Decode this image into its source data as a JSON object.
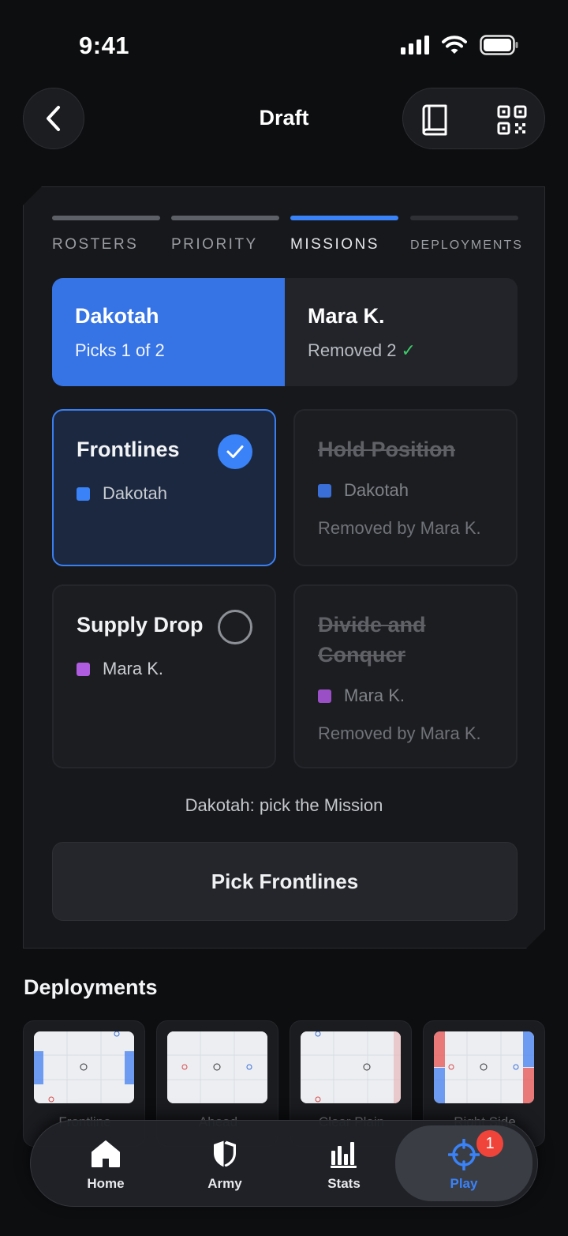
{
  "status": {
    "time": "9:41"
  },
  "header": {
    "title": "Draft",
    "back_icon": "chevron-left-icon",
    "book_icon": "book-icon",
    "qr_icon": "qr-code-icon"
  },
  "steps": [
    {
      "label": "ROSTERS",
      "state": "done"
    },
    {
      "label": "PRIORITY",
      "state": "done"
    },
    {
      "label": "MISSIONS",
      "state": "active"
    },
    {
      "label": "DEPLOYMENTS",
      "state": "pending"
    }
  ],
  "picker": {
    "left": {
      "name": "Dakotah",
      "sub": "Picks 1 of 2"
    },
    "right": {
      "name": "Mara K.",
      "sub": "Removed 2",
      "check": "✓"
    }
  },
  "missions": [
    {
      "title": "Frontlines",
      "owner": "Dakotah",
      "owner_color": "#3a82f7",
      "state": "selected"
    },
    {
      "title": "Hold Position",
      "owner": "Dakotah",
      "owner_color": "#3a6fd8",
      "state": "removed",
      "removed_by": "Removed by Mara K."
    },
    {
      "title": "Supply Drop",
      "owner": "Mara K.",
      "owner_color": "#b05ce0",
      "state": "available"
    },
    {
      "title_line1": "Divide and",
      "title_line2": "Conquer",
      "owner": "Mara K.",
      "owner_color": "#9a4fc6",
      "state": "removed",
      "removed_by": "Removed by Mara K."
    }
  ],
  "prompt": "Dakotah: pick the Mission",
  "pick_button": "Pick Frontlines",
  "deployments": {
    "title": "Deployments",
    "items": [
      {
        "name": "Frontline"
      },
      {
        "name": "Ahead"
      },
      {
        "name": "Clear Plain"
      },
      {
        "name": "Right Side"
      }
    ]
  },
  "tabs": [
    {
      "label": "Home",
      "icon": "home-icon"
    },
    {
      "label": "Army",
      "icon": "shield-icon"
    },
    {
      "label": "Stats",
      "icon": "bar-chart-icon"
    },
    {
      "label": "Play",
      "icon": "crosshair-icon",
      "active": true,
      "badge": "1"
    }
  ],
  "colors": {
    "accent": "#3a82f7",
    "success": "#3ec967",
    "badge": "#f0443a"
  }
}
